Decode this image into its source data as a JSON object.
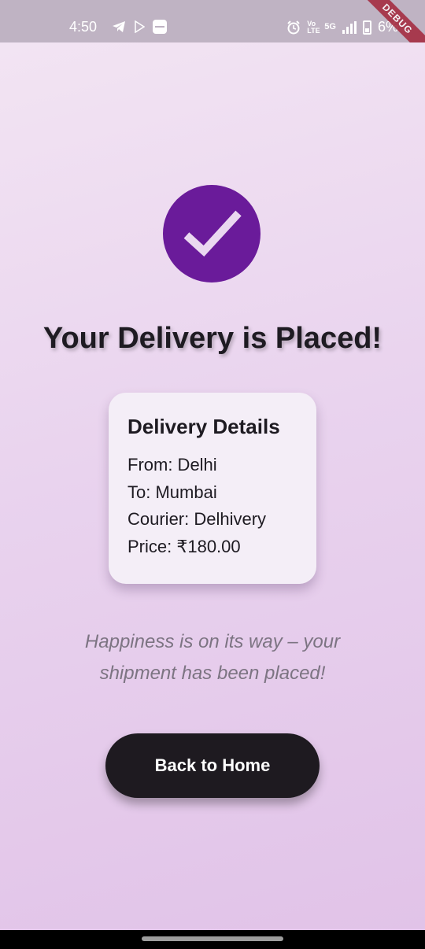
{
  "status_bar": {
    "time": "4:50",
    "network_label": "Vo LTE",
    "network_type": "5G",
    "battery_text": "6%",
    "icons": [
      "telegram-icon",
      "play-store-icon",
      "message-icon",
      "alarm-icon",
      "signal-icon",
      "battery-icon"
    ]
  },
  "debug_banner": "DEBUG",
  "confirmation": {
    "title": "Your Delivery is Placed!",
    "icon": "check-icon",
    "accent_color": "#6a1b9a"
  },
  "delivery_details": {
    "heading": "Delivery Details",
    "from": "From: Delhi",
    "to": "To: Mumbai",
    "courier": "Courier: Delhivery",
    "price": "Price: ₹180.00"
  },
  "tagline": {
    "line1": "Happiness is on its way – your",
    "line2": "shipment has been placed!"
  },
  "actions": {
    "back_home_label": "Back to Home"
  }
}
